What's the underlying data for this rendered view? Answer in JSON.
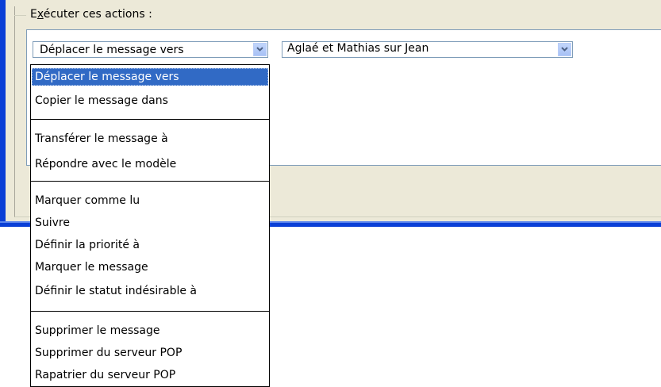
{
  "group": {
    "title_before": "E",
    "title_underlined": "x",
    "title_after": "écuter ces actions :"
  },
  "action_combo": {
    "value": "Déplacer le message vers",
    "button_icon": "chevron-down-icon"
  },
  "folder_combo": {
    "value": "Aglaé et Mathias sur Jean",
    "button_icon": "chevron-down-icon"
  },
  "dropdown": {
    "items": [
      "Déplacer le message vers",
      "Copier le message dans",
      "Transférer le message à",
      "Répondre avec le modèle",
      "Marquer comme lu",
      "Suivre",
      "Définir la priorité à",
      "Marquer le message",
      "Définir le statut indésirable à",
      "Supprimer le message",
      "Supprimer du serveur POP",
      "Rapatrier du serveur POP"
    ],
    "selected_index": 0
  },
  "colors": {
    "dialog_bg": "#ece9d8",
    "window_border": "#0a3fd6",
    "selection": "#316ac5",
    "combo_border": "#7f9db9"
  }
}
